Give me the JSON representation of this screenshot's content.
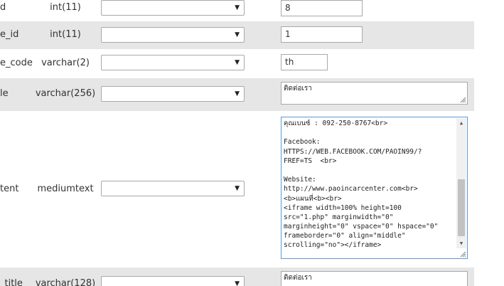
{
  "rows": [
    {
      "name": "d",
      "type": "int(11)",
      "value": "8"
    },
    {
      "name": "e_id",
      "type": "int(11)",
      "value": "1"
    },
    {
      "name": "e_code",
      "type": "varchar(2)",
      "value": "th"
    },
    {
      "name": "le",
      "type": "varchar(256)",
      "value": "ติดต่อเรา"
    },
    {
      "name": "tent",
      "type": "mediumtext",
      "value_lines": [
        "คุณเบนซ์ : 092-250-8767<br>",
        "",
        "Facebook:",
        "HTTPS://WEB.FACEBOOK.COM/PAOIN99/?",
        "FREF=TS  <br>",
        "",
        "Website:",
        "http://www.paoincarcenter.com<br>",
        "<b>แผนที่<b><br>",
        "<iframe width=100% height=100",
        "src=\"1.php\" marginwidth=\"0\"",
        "marginheight=\"0\" vspace=\"0\" hspace=\"0\"",
        "frameborder=\"0\" align=\"middle\"",
        "scrolling=\"no\"></iframe>"
      ]
    },
    {
      "name": "_title",
      "type": "varchar(128)",
      "value": "ติดต่อเรา"
    }
  ],
  "select_arrow": "▼",
  "scroll_up": "▲",
  "scroll_down": "▼",
  "icons": {
    "select_arrow": "chevron-down-icon",
    "resize": "resize-grip-icon"
  },
  "colors": {
    "row_shaded": "#e6e6e6",
    "focus_border": "#5b9bd5"
  }
}
